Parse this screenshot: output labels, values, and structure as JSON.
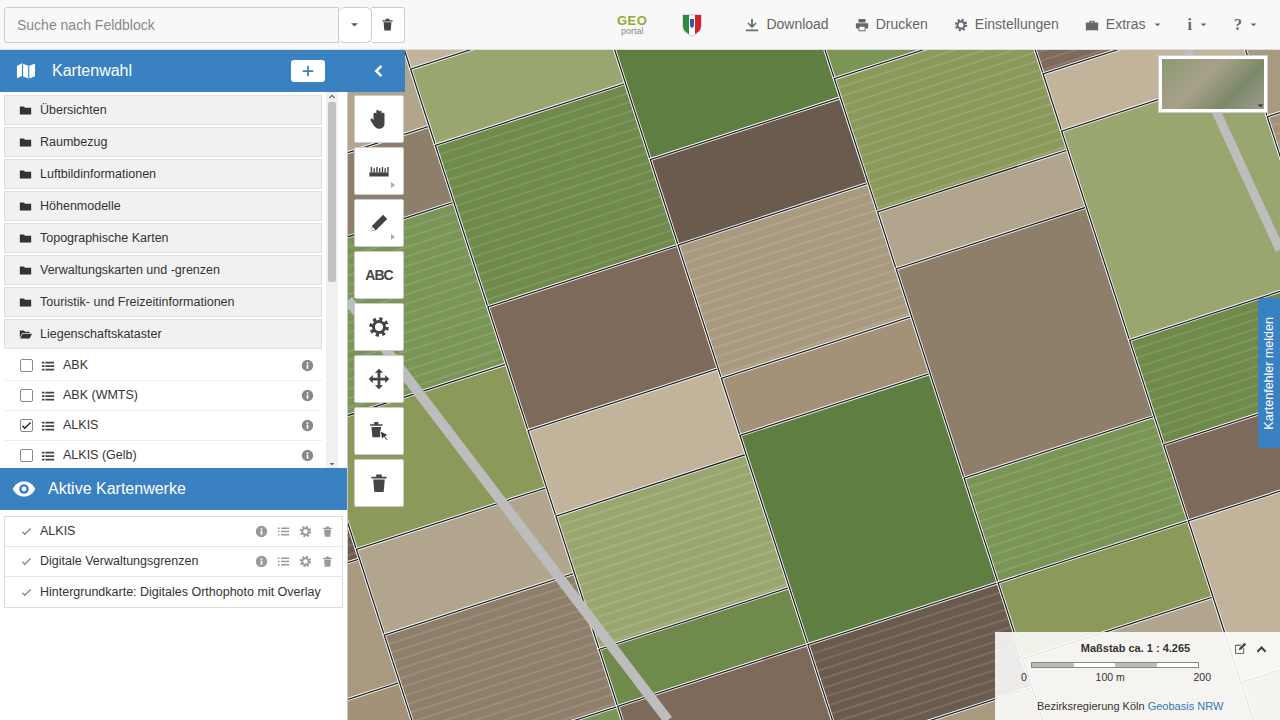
{
  "search": {
    "placeholder": "Suche nach Feldblock"
  },
  "logo": {
    "top": "GEO",
    "bottom": "portal"
  },
  "menu": [
    {
      "label": "Download",
      "kind": "download",
      "dropdown": false
    },
    {
      "label": "Drucken",
      "kind": "print",
      "dropdown": false
    },
    {
      "label": "Einstellungen",
      "kind": "settings",
      "dropdown": false
    },
    {
      "label": "Extras",
      "kind": "extras",
      "dropdown": true
    },
    {
      "label": "i",
      "kind": "info",
      "dropdown": true
    },
    {
      "label": "?",
      "kind": "help",
      "dropdown": true
    }
  ],
  "kartenwahl": {
    "title": "Kartenwahl"
  },
  "folders": [
    {
      "label": "Übersichten",
      "expanded": false
    },
    {
      "label": "Raumbezug",
      "expanded": false
    },
    {
      "label": "Luftbildinformationen",
      "expanded": false
    },
    {
      "label": "Höhenmodelle",
      "expanded": false
    },
    {
      "label": "Topographische Karten",
      "expanded": false
    },
    {
      "label": "Verwaltungskarten und -grenzen",
      "expanded": false
    },
    {
      "label": "Touristik- und Freizeitinformationen",
      "expanded": false
    },
    {
      "label": "Liegenschaftskataster",
      "expanded": true
    }
  ],
  "layers": [
    {
      "label": "ABK",
      "checked": false
    },
    {
      "label": "ABK (WMTS)",
      "checked": false
    },
    {
      "label": "ALKIS",
      "checked": true
    },
    {
      "label": "ALKIS (Gelb)",
      "checked": false
    }
  ],
  "active": {
    "title": "Aktive Kartenwerke",
    "items": [
      {
        "label": "ALKIS",
        "checked": true,
        "tools": true
      },
      {
        "label": "Digitale Verwaltungsgrenzen",
        "checked": true,
        "tools": true
      },
      {
        "label": "Hintergrundkarte: Digitales Orthophoto mit Overlay",
        "checked": true,
        "tools": false
      }
    ]
  },
  "toolbar": [
    {
      "kind": "pan",
      "submenu": false
    },
    {
      "kind": "measure",
      "submenu": true
    },
    {
      "kind": "draw",
      "submenu": true
    },
    {
      "kind": "text",
      "submenu": false,
      "label": "ABC"
    },
    {
      "kind": "settings",
      "submenu": false
    },
    {
      "kind": "move",
      "submenu": false
    },
    {
      "kind": "delete-select",
      "submenu": false
    },
    {
      "kind": "delete-all",
      "submenu": false
    }
  ],
  "map": {
    "report": "Kartenfehler melden"
  },
  "scale": {
    "label": "Maßstab ca. 1 : 4.265",
    "ticks": [
      "0",
      "100 m",
      "200"
    ],
    "attribution": "Bezirksregierung Köln",
    "link": "Geobasis NRW"
  }
}
